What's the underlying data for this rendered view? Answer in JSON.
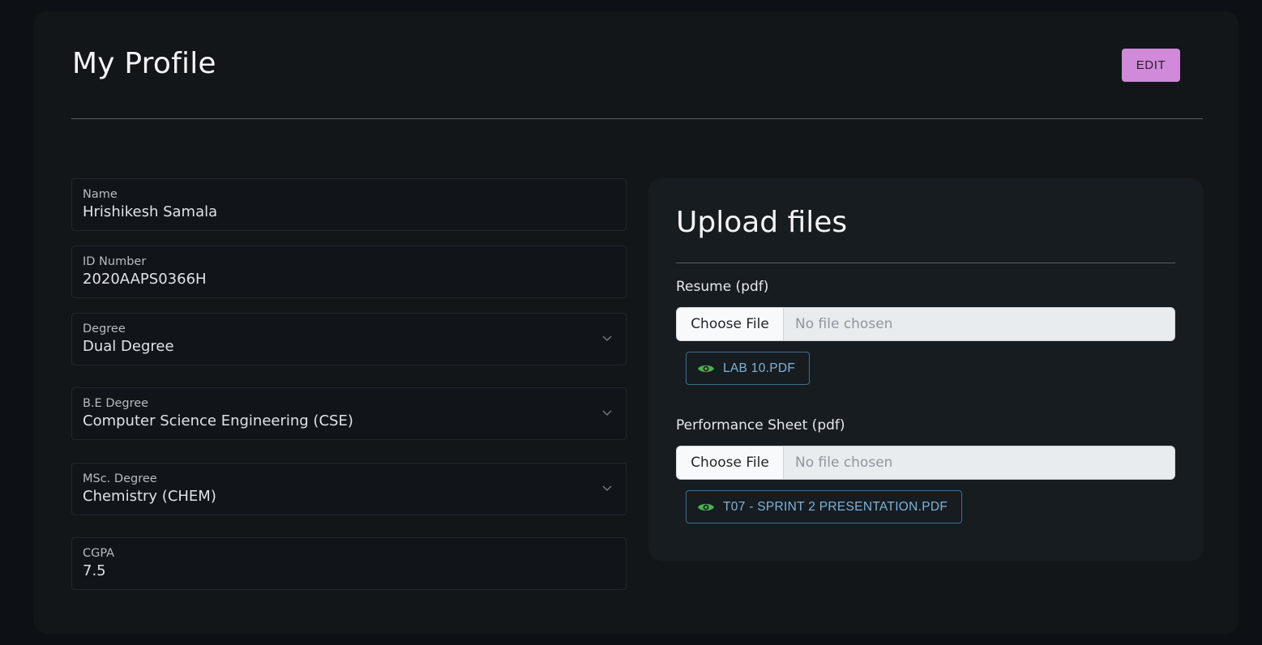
{
  "header": {
    "title": "My Profile",
    "edit_label": "EDIT"
  },
  "profile": {
    "name": {
      "label": "Name",
      "value": "Hrishikesh Samala"
    },
    "id_number": {
      "label": "ID Number",
      "value": "2020AAPS0366H"
    },
    "degree": {
      "label": "Degree",
      "value": "Dual Degree"
    },
    "be_degree": {
      "label": "B.E Degree",
      "value": "Computer Science Engineering (CSE)"
    },
    "msc_degree": {
      "label": "MSc. Degree",
      "value": "Chemistry (CHEM)"
    },
    "cgpa": {
      "label": "CGPA",
      "value": "7.5"
    }
  },
  "uploads": {
    "title": "Upload files",
    "resume": {
      "label": "Resume (pdf)",
      "choose_label": "Choose File",
      "status": "No file chosen",
      "file_name": "LAB 10.PDF"
    },
    "performance": {
      "label": "Performance Sheet (pdf)",
      "choose_label": "Choose File",
      "status": "No file chosen",
      "file_name": "T07 - SPRINT 2 PRESENTATION.PDF"
    }
  },
  "icons": {
    "chevron": "chevron-down-icon",
    "view": "eye-icon"
  },
  "colors": {
    "background": "#0d1115",
    "card": "#121619",
    "accent": "#d08ad9",
    "link": "#7cb4dd",
    "icon_green": "#4caf50"
  }
}
